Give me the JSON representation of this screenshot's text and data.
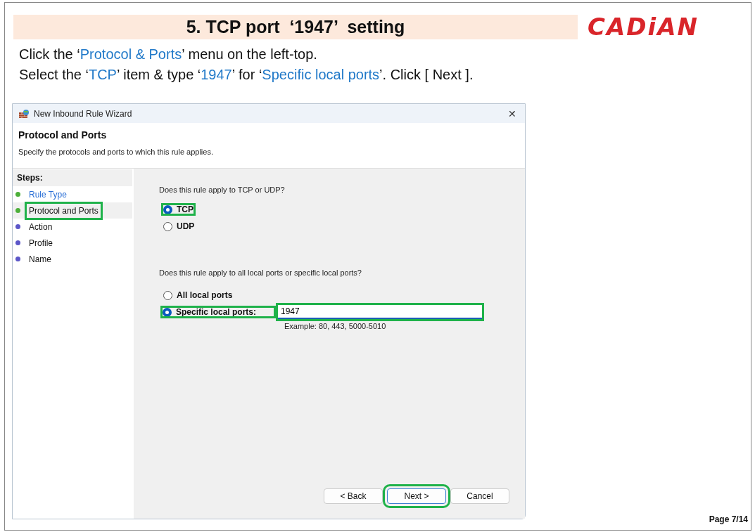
{
  "page": {
    "title": "5. TCP port  ‘1947’  setting",
    "logo": "CADiAN",
    "instructions": [
      [
        {
          "kind": "plain",
          "text": "Click the ‘"
        },
        {
          "kind": "blue",
          "text": "Protocol & Ports"
        },
        {
          "kind": "plain",
          "text": "’ menu on the left-top."
        }
      ],
      [
        {
          "kind": "plain",
          "text": "Select the ‘"
        },
        {
          "kind": "blue",
          "text": "TCP"
        },
        {
          "kind": "plain",
          "text": "’ item & type ‘"
        },
        {
          "kind": "blue",
          "text": "1947"
        },
        {
          "kind": "plain",
          "text": "’ for ‘"
        },
        {
          "kind": "blue",
          "text": "Specific local ports"
        },
        {
          "kind": "plain",
          "text": "’. Click [ Next ]."
        }
      ]
    ],
    "page_number": "Page 7/14"
  },
  "window": {
    "title": "New Inbound Rule Wizard",
    "close": "✕",
    "heading": "Protocol and Ports",
    "subheading": "Specify the protocols and ports to which this rule applies.",
    "steps_title": "Steps:",
    "steps": [
      {
        "label": "Rule Type",
        "done": true,
        "selected": false,
        "highlighted": false
      },
      {
        "label": "Protocol and Ports",
        "done": true,
        "selected": true,
        "highlighted": true
      },
      {
        "label": "Action",
        "done": false,
        "selected": false,
        "highlighted": false
      },
      {
        "label": "Profile",
        "done": false,
        "selected": false,
        "highlighted": false
      },
      {
        "label": "Name",
        "done": false,
        "selected": false,
        "highlighted": false
      }
    ],
    "protocol_question": "Does this rule apply to TCP or UDP?",
    "protocols": [
      {
        "label": "TCP",
        "selected": true,
        "highlighted": true
      },
      {
        "label": "UDP",
        "selected": false,
        "highlighted": false
      }
    ],
    "ports_question": "Does this rule apply to all local ports or specific local ports?",
    "ports": [
      {
        "label": "All local ports",
        "selected": false,
        "highlighted": false
      },
      {
        "label": "Specific local ports:",
        "selected": true,
        "highlighted": true
      }
    ],
    "port_field": {
      "value": "1947",
      "highlighted": true
    },
    "port_example": "Example: 80, 443, 5000-5010",
    "buttons": [
      {
        "label": "< Back",
        "highlighted": false,
        "default": false
      },
      {
        "label": "Next >",
        "highlighted": true,
        "default": true
      },
      {
        "label": "Cancel",
        "highlighted": false,
        "default": false
      }
    ]
  }
}
